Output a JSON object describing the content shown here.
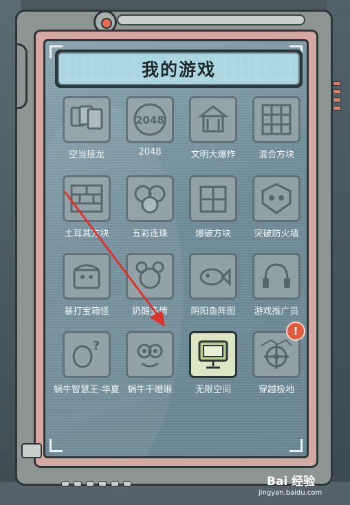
{
  "screen": {
    "title": "我的游戏"
  },
  "games": [
    {
      "label": "空当接龙",
      "icon": "cards-icon"
    },
    {
      "label": "2048",
      "icon": "2048-icon"
    },
    {
      "label": "文明大爆炸",
      "icon": "temple-icon"
    },
    {
      "label": "混合方块",
      "icon": "blocks-grid-icon"
    },
    {
      "label": "土耳其方块",
      "icon": "brick-wall-icon"
    },
    {
      "label": "五彩连珠",
      "icon": "balls-icon"
    },
    {
      "label": "爆破方块",
      "icon": "explode-block-icon"
    },
    {
      "label": "突破防火墙",
      "icon": "shield-robot-icon"
    },
    {
      "label": "暴打宝箱怪",
      "icon": "chest-monster-icon"
    },
    {
      "label": "奶酪多情",
      "icon": "mouse-icon"
    },
    {
      "label": "阴阳鱼阵图",
      "icon": "fish-icon"
    },
    {
      "label": "游戏推广员",
      "icon": "headset-icon"
    },
    {
      "label": "蜗牛智慧王-华夏",
      "icon": "lantern-question-icon"
    },
    {
      "label": "蜗牛干瞪眼",
      "icon": "snail-face-icon"
    },
    {
      "label": "无限空间",
      "icon": "monitor-icon",
      "active": true
    },
    {
      "label": "穿越极地",
      "icon": "ship-wheel-icon",
      "badge": "!"
    }
  ],
  "watermark": {
    "brand": "Bai 经验",
    "url": "jingyan.baidu.com"
  },
  "colors": {
    "screen": "#7a97a3",
    "title_bg": "#a9d6e1",
    "active_icon": "#dce6c2",
    "badge": "#e25b3e",
    "arrow": "#e0322a"
  }
}
